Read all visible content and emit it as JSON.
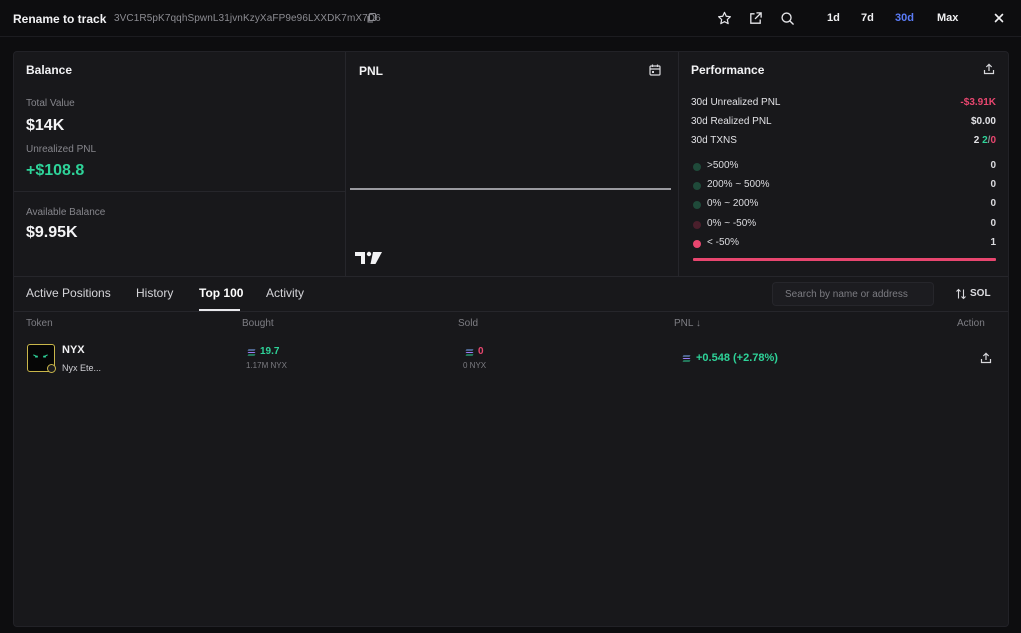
{
  "header": {
    "wallet_name": "Rename to track",
    "address": "3VC1R5pK7qqhSpwnL31jvnKzyXaFP9e96LXXDK7mX7D6",
    "ranges": [
      "1d",
      "7d",
      "30d",
      "Max"
    ],
    "active_range": "30d"
  },
  "balance": {
    "title": "Balance",
    "total_value_label": "Total Value",
    "total_value": "$14K",
    "unrealized_pnl_label": "Unrealized PNL",
    "unrealized_pnl": "+$108.8",
    "available_balance_label": "Available Balance",
    "available_balance": "$9.95K"
  },
  "pnl_chart": {
    "title": "PNL"
  },
  "performance": {
    "title": "Performance",
    "stats": [
      {
        "label": "30d Unrealized PNL",
        "value": "-$3.91K"
      },
      {
        "label": "30d Realized PNL",
        "value": "$0.00"
      },
      {
        "label": "30d TXNS",
        "total": "2",
        "buys": "2",
        "sep": "/",
        "sells": "0"
      }
    ],
    "distribution": [
      {
        "label": ">500%",
        "count": "0",
        "color": "#1f4a3a"
      },
      {
        "label": "200% ~ 500%",
        "count": "0",
        "color": "#1f4a3a"
      },
      {
        "label": "0% ~ 200%",
        "count": "0",
        "color": "#1f4a3a"
      },
      {
        "label": "0% ~ -50%",
        "count": "0",
        "color": "#4a1f2c"
      },
      {
        "label": "< -50%",
        "count": "1",
        "color": "#e8466f"
      }
    ]
  },
  "tabs": [
    "Active Positions",
    "History",
    "Top 100",
    "Activity"
  ],
  "active_tab": "Top 100",
  "search": {
    "placeholder": "Search by name or address"
  },
  "currency_toggle": "SOL",
  "table": {
    "columns": [
      "Token",
      "Bought",
      "Sold",
      "PNL ↓",
      "Action"
    ],
    "rows": [
      {
        "symbol": "NYX",
        "name": "Nyx Ete...",
        "bought": "19.7",
        "bought_sub": "1.17M NYX",
        "sold": "0",
        "sold_sub": "0 NYX",
        "pnl": "+0.548 (+2.78%)"
      }
    ]
  },
  "colors": {
    "accent": "#5b7cf7",
    "positive": "#2ed399",
    "negative": "#e8466f",
    "panel": "#18181b",
    "background": "#0d0d0f"
  }
}
